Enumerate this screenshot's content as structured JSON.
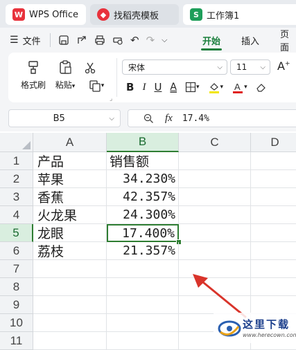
{
  "tabs": {
    "wps": "WPS Office",
    "template": "找稻壳模板",
    "workbook": "工作簿1"
  },
  "menu": {
    "file": "文件",
    "start": "开始",
    "insert": "插入",
    "page": "页面"
  },
  "ribbon": {
    "format_painter": "格式刷",
    "paste": "粘贴",
    "font_name": "宋体",
    "font_size": "11"
  },
  "formula_bar": {
    "name_box": "B5",
    "fx": "fx",
    "value": "17.4%"
  },
  "grid": {
    "columns": [
      "A",
      "B",
      "C",
      "D"
    ],
    "rows": [
      "1",
      "2",
      "3",
      "4",
      "5",
      "6",
      "7",
      "8",
      "9",
      "10",
      "11"
    ],
    "header_row": [
      "产品",
      "销售额"
    ],
    "data": [
      [
        "苹果",
        "34.230%"
      ],
      [
        "香蕉",
        "42.357%"
      ],
      [
        "火龙果",
        "24.300%"
      ],
      [
        "龙眼",
        "17.400%"
      ],
      [
        "荔枝",
        "21.357%"
      ]
    ]
  },
  "colors": {
    "accent": "#2e7d32",
    "wps_red": "#e8323c",
    "sheet_green": "#1e9e5a",
    "arrow_red": "#d9342b"
  },
  "watermark": {
    "title": "这里下载",
    "url": "www.herecown.com"
  }
}
